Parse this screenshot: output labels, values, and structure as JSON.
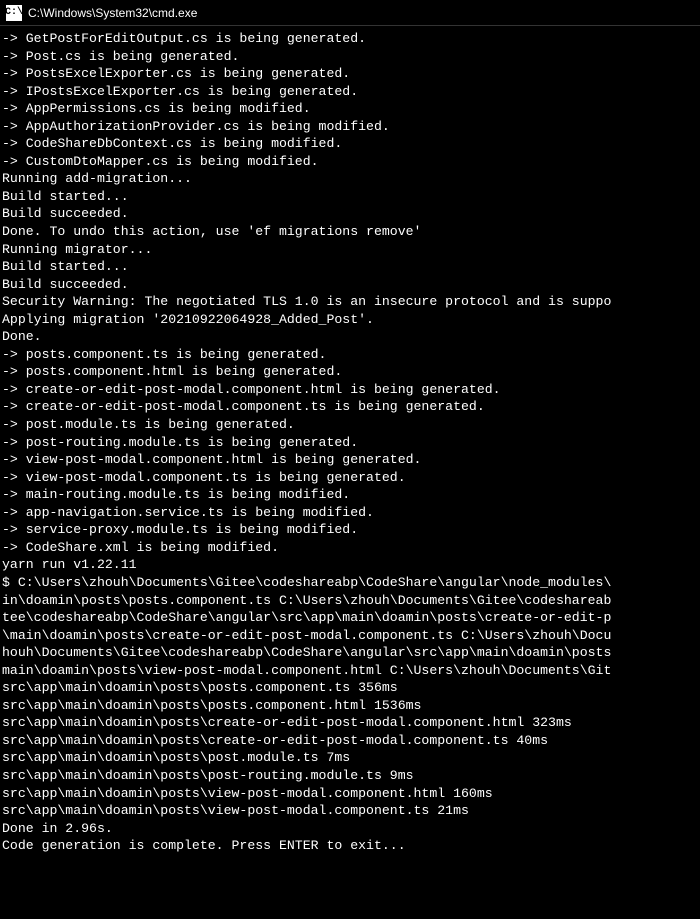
{
  "window": {
    "title": "C:\\Windows\\System32\\cmd.exe",
    "icon_label": "C:\\"
  },
  "lines": [
    "-> GetPostForEditOutput.cs is being generated.",
    "-> Post.cs is being generated.",
    "-> PostsExcelExporter.cs is being generated.",
    "-> IPostsExcelExporter.cs is being generated.",
    "-> AppPermissions.cs is being modified.",
    "-> AppAuthorizationProvider.cs is being modified.",
    "-> CodeShareDbContext.cs is being modified.",
    "-> CustomDtoMapper.cs is being modified.",
    "Running add-migration...",
    "Build started...",
    "Build succeeded.",
    "Done. To undo this action, use 'ef migrations remove'",
    "Running migrator...",
    "Build started...",
    "Build succeeded.",
    "Security Warning: The negotiated TLS 1.0 is an insecure protocol and is suppo",
    "Applying migration '20210922064928_Added_Post'.",
    "Done.",
    "-> posts.component.ts is being generated.",
    "-> posts.component.html is being generated.",
    "-> create-or-edit-post-modal.component.html is being generated.",
    "-> create-or-edit-post-modal.component.ts is being generated.",
    "-> post.module.ts is being generated.",
    "-> post-routing.module.ts is being generated.",
    "-> view-post-modal.component.html is being generated.",
    "-> view-post-modal.component.ts is being generated.",
    "-> main-routing.module.ts is being modified.",
    "-> app-navigation.service.ts is being modified.",
    "-> service-proxy.module.ts is being modified.",
    "-> CodeShare.xml is being modified.",
    "yarn run v1.22.11",
    "$ C:\\Users\\zhouh\\Documents\\Gitee\\codeshareabp\\CodeShare\\angular\\node_modules\\",
    "in\\doamin\\posts\\posts.component.ts C:\\Users\\zhouh\\Documents\\Gitee\\codeshareab",
    "tee\\codeshareabp\\CodeShare\\angular\\src\\app\\main\\doamin\\posts\\create-or-edit-p",
    "\\main\\doamin\\posts\\create-or-edit-post-modal.component.ts C:\\Users\\zhouh\\Docu",
    "houh\\Documents\\Gitee\\codeshareabp\\CodeShare\\angular\\src\\app\\main\\doamin\\posts",
    "main\\doamin\\posts\\view-post-modal.component.html C:\\Users\\zhouh\\Documents\\Git",
    "src\\app\\main\\doamin\\posts\\posts.component.ts 356ms",
    "src\\app\\main\\doamin\\posts\\posts.component.html 1536ms",
    "src\\app\\main\\doamin\\posts\\create-or-edit-post-modal.component.html 323ms",
    "src\\app\\main\\doamin\\posts\\create-or-edit-post-modal.component.ts 40ms",
    "src\\app\\main\\doamin\\posts\\post.module.ts 7ms",
    "src\\app\\main\\doamin\\posts\\post-routing.module.ts 9ms",
    "src\\app\\main\\doamin\\posts\\view-post-modal.component.html 160ms",
    "src\\app\\main\\doamin\\posts\\view-post-modal.component.ts 21ms",
    "Done in 2.96s.",
    "",
    "Code generation is complete. Press ENTER to exit..."
  ]
}
